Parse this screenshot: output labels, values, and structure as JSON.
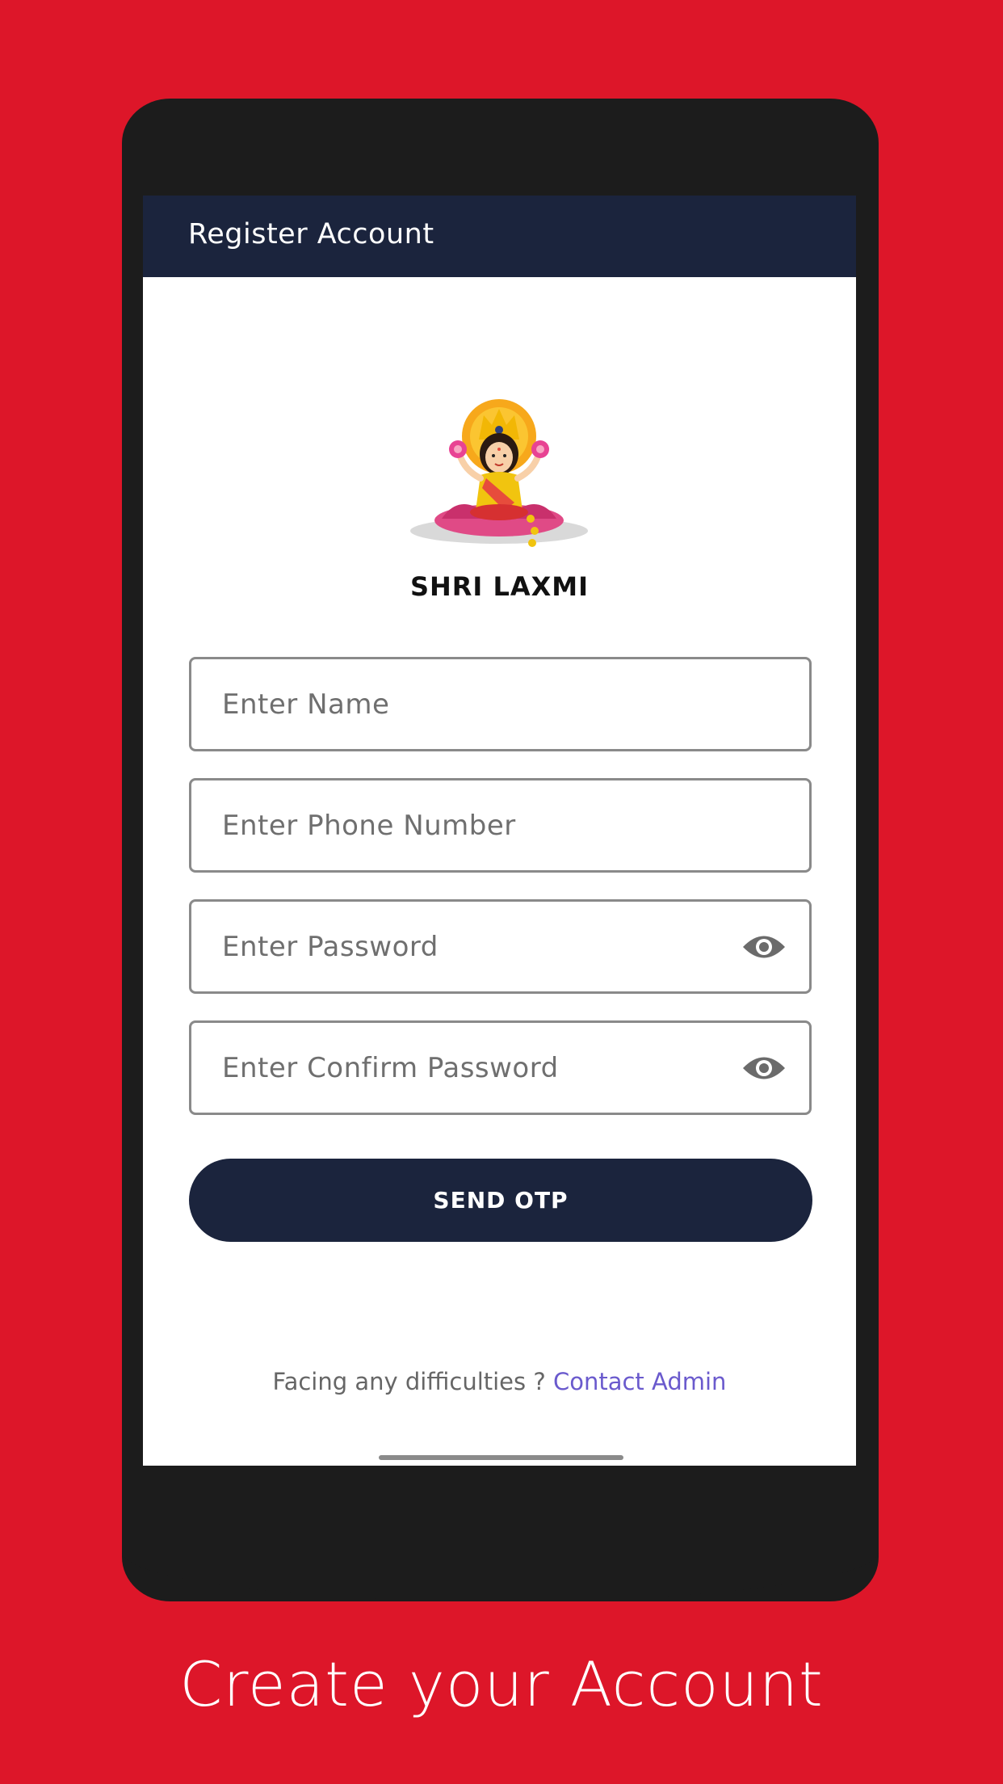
{
  "app_bar": {
    "title": "Register Account"
  },
  "brand": {
    "name": "SHRI LAXMI",
    "logo_icon": "goddess-laxmi-logo"
  },
  "form": {
    "name_placeholder": "Enter Name",
    "phone_placeholder": "Enter Phone Number",
    "password_placeholder": "Enter Password",
    "confirm_password_placeholder": "Enter Confirm Password",
    "visibility_icon": "eye-icon",
    "submit_label": "SEND OTP"
  },
  "help": {
    "text": "Facing any difficulties ?",
    "link": "Contact Admin"
  },
  "caption": "Create your Account",
  "colors": {
    "background": "#dd1629",
    "primary": "#1b243d",
    "link": "#6a5acd",
    "phone_frame": "#1c1c1c"
  }
}
